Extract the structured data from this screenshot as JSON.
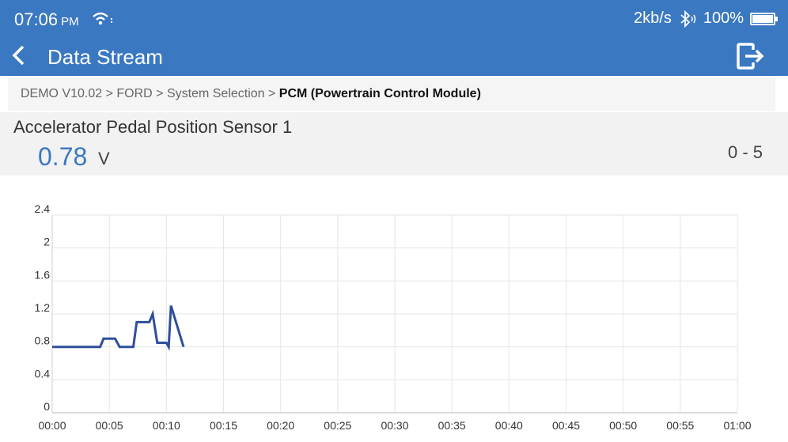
{
  "status": {
    "time": "07:06",
    "ampm": "PM",
    "speed": "2kb/s",
    "battery": "100%"
  },
  "header": {
    "title": "Data Stream"
  },
  "breadcrumb": {
    "path": "DEMO V10.02 > FORD > System Selection > ",
    "current": "PCM (Powertrain Control Module)"
  },
  "sensor": {
    "name": "Accelerator Pedal Position Sensor 1",
    "value": "0.78",
    "unit": "V",
    "range": "0 - 5"
  },
  "colors": {
    "appbar": "#3a78c2",
    "line": "#2e4f9a",
    "value": "#3a78c2"
  },
  "chart_data": {
    "type": "line",
    "series": [
      {
        "x": [
          0,
          4.2,
          4.5,
          5.5,
          5.9,
          7.1,
          7.4,
          8.5,
          8.8,
          9.2,
          10,
          10.2,
          10.4,
          11.5
        ],
        "y": [
          0.8,
          0.8,
          0.9,
          0.9,
          0.8,
          0.8,
          1.1,
          1.1,
          1.2,
          0.85,
          0.85,
          0.8,
          1.3,
          0.8
        ]
      }
    ],
    "x_ticks": [
      "00:00",
      "00:05",
      "00:10",
      "00:15",
      "00:20",
      "00:25",
      "00:30",
      "00:35",
      "00:40",
      "00:45",
      "00:50",
      "00:55",
      "01:00"
    ],
    "y_ticks": [
      "0",
      "0.4",
      "0.8",
      "1.2",
      "1.6",
      "2",
      "2.4"
    ],
    "xlim": [
      0,
      60
    ],
    "ylim": [
      0,
      2.4
    ],
    "grid": true
  }
}
